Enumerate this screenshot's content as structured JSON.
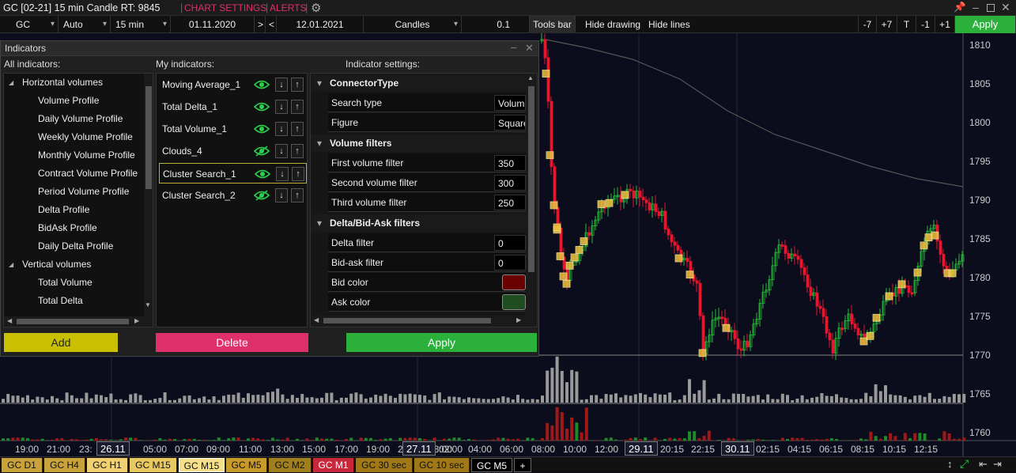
{
  "title": {
    "instrument": "GC [02-21] 15 min Candle RT: 9845",
    "chart_settings": "CHART SETTINGS",
    "alerts": "ALERTS"
  },
  "toolbar": {
    "symbol": "GC",
    "mode": "Auto",
    "timeframe": "15 min",
    "date_from": "01.11.2020",
    "nav_next": ">",
    "nav_prev": "<",
    "date_to": "12.01.2021",
    "chart_type": "Candles",
    "step": "0.1",
    "tools_bar": "Tools bar",
    "hide_drawing": "Hide drawing",
    "hide_lines": "Hide lines",
    "zoom_buttons": [
      "-7",
      "+7",
      "T",
      "-1",
      "+1"
    ],
    "apply": "Apply"
  },
  "panel": {
    "title": "Indicators",
    "all_label": "All indicators:",
    "my_label": "My indicators:",
    "settings_label": "Indicator settings:",
    "all_indicators": [
      {
        "label": "Horizontal volumes",
        "group": true
      },
      {
        "label": "Volume Profile"
      },
      {
        "label": "Daily Volume Profile"
      },
      {
        "label": "Weekly Volume Profile"
      },
      {
        "label": "Monthly Volume Profile"
      },
      {
        "label": "Contract Volume Profile"
      },
      {
        "label": "Period Volume Profile"
      },
      {
        "label": "Delta Profile"
      },
      {
        "label": "BidAsk Profile"
      },
      {
        "label": "Daily Delta Profile"
      },
      {
        "label": "Vertical volumes",
        "group": true
      },
      {
        "label": "Total Volume"
      },
      {
        "label": "Total Delta"
      }
    ],
    "my_indicators": [
      {
        "label": "Moving Average_1",
        "visible": true
      },
      {
        "label": "Total Delta_1",
        "visible": true
      },
      {
        "label": "Total Volume_1",
        "visible": true
      },
      {
        "label": "Clouds_4",
        "visible": false
      },
      {
        "label": "Cluster Search_1",
        "visible": true,
        "selected": true
      },
      {
        "label": "Cluster Search_2",
        "visible": false
      }
    ],
    "sections": [
      {
        "title": "ConnectorType",
        "rows": [
          {
            "key": "Search type",
            "value": "Volume"
          },
          {
            "key": "Figure",
            "value": "Square"
          }
        ]
      },
      {
        "title": "Volume filters",
        "rows": [
          {
            "key": "First volume filter",
            "value": "350"
          },
          {
            "key": "Second volume filter",
            "value": "300"
          },
          {
            "key": "Third volume filter",
            "value": "250"
          }
        ]
      },
      {
        "title": "Delta/Bid-Ask filters",
        "rows": [
          {
            "key": "Delta filter",
            "value": "0"
          },
          {
            "key": "Bid-ask filter",
            "value": "0"
          },
          {
            "key": "Bid color",
            "value": "",
            "color": "#6b0000"
          },
          {
            "key": "Ask color",
            "value": "",
            "color": "#1f4d1f"
          }
        ]
      }
    ],
    "add": "Add",
    "delete": "Delete",
    "apply": "Apply"
  },
  "chart": {
    "price_labels": [
      "1810",
      "1805",
      "1800",
      "1795",
      "1790",
      "1785",
      "1780",
      "1775",
      "1770",
      "1765",
      "1760"
    ],
    "time_labels": [
      "19:00",
      "21:00",
      "23:",
      "26.11",
      "05:00",
      "07:00",
      "09:00",
      "11:00",
      "13:00",
      "15:00",
      "17:00",
      "19:00",
      "21:00",
      "23:00",
      "27.11",
      "02:00",
      "04:00",
      "06:00",
      "08:00",
      "10:00",
      "12:00",
      "29.11",
      "20:15",
      "22:15",
      "30.11",
      "02:15",
      "04:15",
      "06:15",
      "08:15",
      "10:15",
      "12:15"
    ],
    "date_highlights": [
      "26.11",
      "27.11",
      "29.11",
      "30.11"
    ]
  },
  "tabs": [
    {
      "label": "GC D1",
      "color": "#c8a23a"
    },
    {
      "label": "GC H4",
      "color": "#c8a23a"
    },
    {
      "label": "GC H1",
      "color": "#f0d070"
    },
    {
      "label": "GC M15",
      "color": "#e8c860"
    },
    {
      "label": "GC M15",
      "color": "#f7e08a",
      "active": true
    },
    {
      "label": "GC M5",
      "color": "#c89a2a"
    },
    {
      "label": "GC M2",
      "color": "#a0801e"
    },
    {
      "label": "GC M1",
      "color": "#c8283c"
    },
    {
      "label": "GC 30 sec",
      "color": "#a07818"
    },
    {
      "label": "GC 10 sec",
      "color": "#a07818"
    },
    {
      "label": "GC M5",
      "color": "#000000"
    },
    {
      "label": "+",
      "color": "#000000"
    }
  ]
}
